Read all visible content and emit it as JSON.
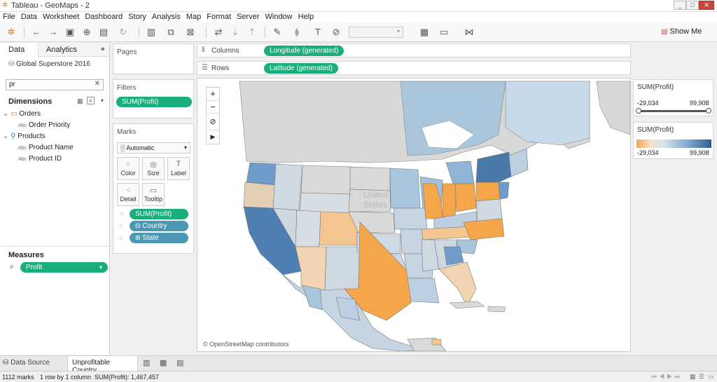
{
  "window": {
    "title": "Tableau - GeoMaps - 2"
  },
  "menu": [
    "File",
    "Data",
    "Worksheet",
    "Dashboard",
    "Story",
    "Analysis",
    "Map",
    "Format",
    "Server",
    "Window",
    "Help"
  ],
  "toolbar": {
    "show_me": "Show Me"
  },
  "left": {
    "tab_data": "Data",
    "tab_analytics": "Analytics",
    "datasource": "Global Superstore 2016",
    "search_value": "pr",
    "dimensions_label": "Dimensions",
    "tree": [
      {
        "type": "folder",
        "label": "Orders"
      },
      {
        "type": "field",
        "label": "Order Priority",
        "badge": "Abc"
      },
      {
        "type": "folder",
        "label": "Products"
      },
      {
        "type": "field",
        "label": "Product Name",
        "badge": "Abc"
      },
      {
        "type": "field",
        "label": "Product ID",
        "badge": "Abc"
      }
    ],
    "measures_label": "Measures",
    "measure_pill": "Profit"
  },
  "shelves": {
    "pages": "Pages",
    "columns": "Columns",
    "rows": "Rows",
    "columns_pill": "Longitude (generated)",
    "rows_pill": "Latitude (generated)",
    "filters": "Filters",
    "filter_pill": "SUM(Profit)",
    "marks": "Marks",
    "mark_type": "Automatic",
    "mark_buttons": [
      "Color",
      "Size",
      "Label",
      "Detail",
      "Tooltip"
    ],
    "mark_pills": [
      "SUM(Profit)",
      "Country",
      "State"
    ]
  },
  "map": {
    "watermark1": "United",
    "watermark2": "States",
    "attribution": "© OpenStreetMap contributors",
    "zoom_in": "+",
    "zoom_out": "−",
    "colors": {
      "negative": "#f5a54a",
      "positive": "#4a78a8",
      "neutral": "#d7d7d7",
      "water": "#ffffff",
      "land_nodata": "#d9d9d9"
    }
  },
  "legends": {
    "filter_title": "SUM(Profit)",
    "filter_min": "-29,034",
    "filter_max": "99,908",
    "color_title": "SUM(Profit)",
    "color_min": "-29,034",
    "color_max": "99,908"
  },
  "tabs": {
    "datasource": "Data Source",
    "sheet": "Unprofitable Country"
  },
  "status": {
    "marks": "1112 marks",
    "rows": "1 row by 1 column",
    "sum": "SUM(Profit): 1,467,457"
  }
}
